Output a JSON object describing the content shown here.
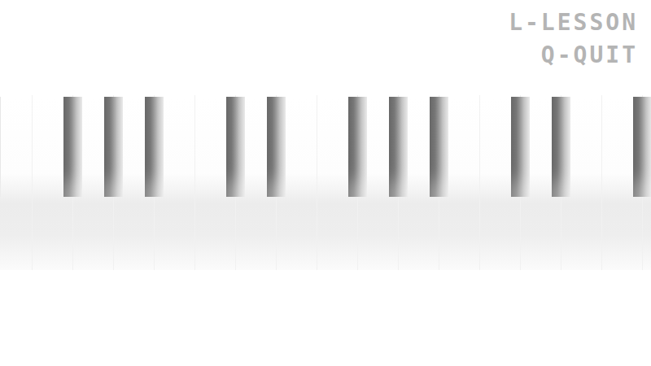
{
  "menu": [
    {
      "label": "L-LESSON"
    },
    {
      "label": "Q-QUIT"
    }
  ],
  "keyboard": {
    "white_keys": [
      {
        "black_after": true
      },
      {
        "black_after": false
      },
      {
        "black_after": true
      },
      {
        "black_after": true
      },
      {
        "black_after": true
      },
      {
        "black_after": false
      },
      {
        "black_after": true
      },
      {
        "black_after": true
      },
      {
        "black_after": false
      },
      {
        "black_after": true
      },
      {
        "black_after": true
      },
      {
        "black_after": true
      },
      {
        "black_after": false
      },
      {
        "black_after": true
      },
      {
        "black_after": true
      },
      {
        "black_after": false
      },
      {
        "black_after": true
      },
      {
        "black_after": false
      }
    ]
  }
}
